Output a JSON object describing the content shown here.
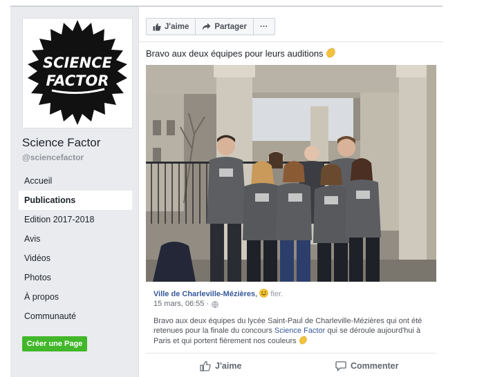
{
  "sidebar": {
    "logo_text": [
      "SCIENCE",
      "FACTOR"
    ],
    "page_name": "Science Factor",
    "handle": "@sciencefactor",
    "nav_items": [
      {
        "label": "Accueil"
      },
      {
        "label": "Publications"
      },
      {
        "label": "Edition 2017-2018"
      },
      {
        "label": "Avis"
      },
      {
        "label": "Vidéos"
      },
      {
        "label": "Photos"
      },
      {
        "label": "À propos"
      },
      {
        "label": "Communauté"
      }
    ],
    "active_nav": "Publications",
    "create_page_label": "Créer une Page"
  },
  "post": {
    "action_bar": {
      "like_label": "J'aime",
      "share_label": "Partager",
      "more_label": "···"
    },
    "caption": "Bravo aux deux équipes pour leurs auditions",
    "shared": {
      "author": "Ville de Charleville-Mézières",
      "author_suffix": ",",
      "feeling": "fier.",
      "timestamp": "15 mars, 06:55 ·",
      "text_part1": "Bravo aux deux équipes du lycée Saint-Paul de Charleville-Mézières qui ont été retenues pour la finale du concours",
      "link_text": "Science Factor",
      "text_part2": "qui se déroule aujourd'hui à Paris et qui portent fièrement nos couleurs"
    },
    "footer": {
      "like_label": "J'aime",
      "comment_label": "Commenter"
    }
  },
  "colors": {
    "brand_blue": "#365899",
    "create_green": "#42b72a",
    "background_gray": "#e9ebee"
  },
  "icons": [
    "thumbs-up-icon",
    "share-arrow-icon",
    "clap-emoji-icon",
    "smile-emoji-icon",
    "globe-icon",
    "comment-icon"
  ]
}
